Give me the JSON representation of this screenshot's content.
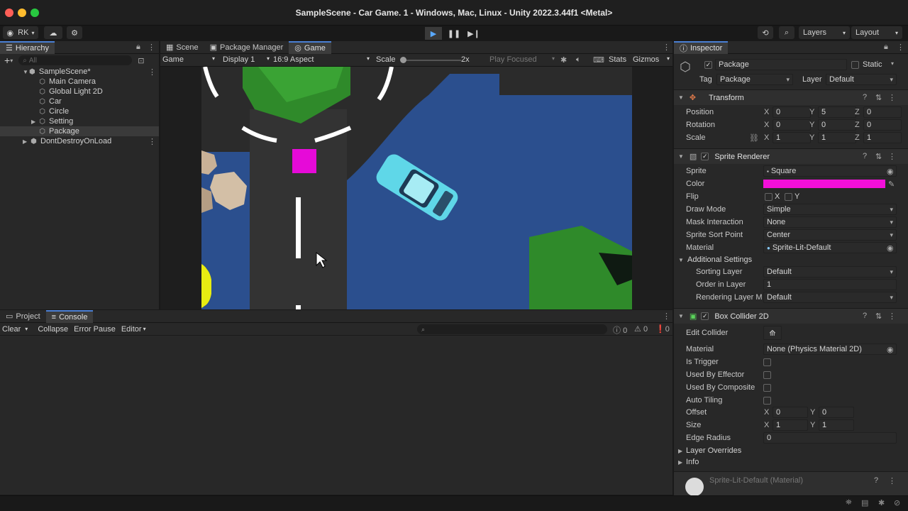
{
  "window": {
    "title": "SampleScene - Car Game. 1 - Windows, Mac, Linux - Unity 2022.3.44f1 <Metal>",
    "colors": {
      "close": "#ff5f57",
      "minimize": "#febc2e",
      "maximize": "#28c840"
    }
  },
  "toolbar": {
    "account": "RK",
    "layers": "Layers",
    "layout": "Layout"
  },
  "hierarchy": {
    "tab": "Hierarchy",
    "search_placeholder": "All",
    "scene": "SampleScene*",
    "items": [
      "Main Camera",
      "Global Light 2D",
      "Car",
      "Circle",
      "Setting",
      "Package"
    ],
    "dont_destroy": "DontDestroyOnLoad"
  },
  "center_tabs": {
    "scene": "Scene",
    "package_manager": "Package Manager",
    "game": "Game"
  },
  "game_bar": {
    "view": "Game",
    "display": "Display 1",
    "aspect": "16:9 Aspect",
    "scale_label": "Scale",
    "scale_value": "2x",
    "play_focused": "Play Focused",
    "stats": "Stats",
    "gizmos": "Gizmos"
  },
  "game_colors": {
    "road": "#3a3a3a",
    "water": "#2b4f8e",
    "grass": "#2f8a2a",
    "package": "#e60ad8",
    "car": "#5fd7e8",
    "sun": "#e7ec12"
  },
  "bottom": {
    "project_tab": "Project",
    "console_tab": "Console",
    "clear": "Clear",
    "collapse": "Collapse",
    "error_pause": "Error Pause",
    "editor": "Editor",
    "counts": {
      "info": "0",
      "warn": "0",
      "error": "0"
    }
  },
  "inspector": {
    "tab": "Inspector",
    "object_name": "Package",
    "static": "Static",
    "tag_label": "Tag",
    "tag_value": "Package",
    "layer_label": "Layer",
    "layer_value": "Default",
    "transform": {
      "title": "Transform",
      "position": {
        "label": "Position",
        "x": "0",
        "y": "5",
        "z": "0"
      },
      "rotation": {
        "label": "Rotation",
        "x": "0",
        "y": "0",
        "z": "0"
      },
      "scale": {
        "label": "Scale",
        "x": "1",
        "y": "1",
        "z": "1"
      }
    },
    "sprite_renderer": {
      "title": "Sprite Renderer",
      "sprite_label": "Sprite",
      "sprite_value": "Square",
      "color_label": "Color",
      "color_value": "#f20fd9",
      "flip_label": "Flip",
      "flip_x": "X",
      "flip_y": "Y",
      "draw_mode_label": "Draw Mode",
      "draw_mode_value": "Simple",
      "mask_label": "Mask Interaction",
      "mask_value": "None",
      "sort_point_label": "Sprite Sort Point",
      "sort_point_value": "Center",
      "material_label": "Material",
      "material_value": "Sprite-Lit-Default",
      "additional": "Additional Settings",
      "sorting_layer_label": "Sorting Layer",
      "sorting_layer_value": "Default",
      "order_label": "Order in Layer",
      "order_value": "1",
      "render_layer_label": "Rendering Layer M",
      "render_layer_value": "Default"
    },
    "box_collider": {
      "title": "Box Collider 2D",
      "edit_collider": "Edit Collider",
      "material_label": "Material",
      "material_value": "None (Physics Material 2D)",
      "is_trigger": "Is Trigger",
      "used_by_effector": "Used By Effector",
      "used_by_composite": "Used By Composite",
      "auto_tiling": "Auto Tiling",
      "offset_label": "Offset",
      "offset_x": "0",
      "offset_y": "0",
      "size_label": "Size",
      "size_x": "1",
      "size_y": "1",
      "edge_radius_label": "Edge Radius",
      "edge_radius_value": "0",
      "layer_overrides": "Layer Overrides",
      "info": "Info"
    },
    "material_preview": "Sprite-Lit-Default (Material)"
  }
}
